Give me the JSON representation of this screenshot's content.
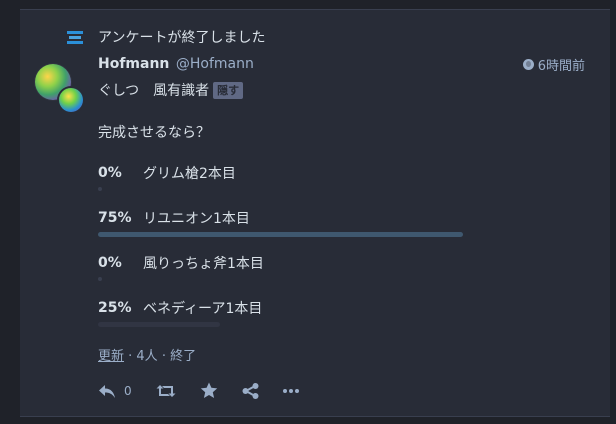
{
  "prepend": {
    "text": "アンケートが終了しました",
    "icon": "poll-icon"
  },
  "account": {
    "display_name": "Hofmann",
    "acct": "@Hofmann"
  },
  "status": {
    "time": "6時間前",
    "visibility_icon": "globe-icon",
    "spoiler_text": "ぐしつ　風有識者",
    "spoiler_button": "隠す",
    "content": "完成させるなら？"
  },
  "poll": {
    "options": [
      {
        "percent": "0%",
        "label": "グリム槍2本目",
        "value": 0
      },
      {
        "percent": "75%",
        "label": "リユニオン1本目",
        "value": 75,
        "leading": true
      },
      {
        "percent": "0%",
        "label": "風りっちょ斧1本目",
        "value": 0
      },
      {
        "percent": "25%",
        "label": "ベネディーア1本目",
        "value": 25
      }
    ],
    "refresh_label": "更新",
    "footer_rest": " · 4人 · 終了"
  },
  "actions": {
    "reply_count": "0",
    "icons": [
      "reply-icon",
      "boost-icon",
      "favourite-icon",
      "share-icon",
      "more-icon"
    ]
  },
  "colors": {
    "background": "#1f2229",
    "card": "#282c37",
    "accent": "#2b90d9",
    "text": "#d9e1e8",
    "muted": "#9baec8",
    "leading_bar": "#3f586f"
  }
}
